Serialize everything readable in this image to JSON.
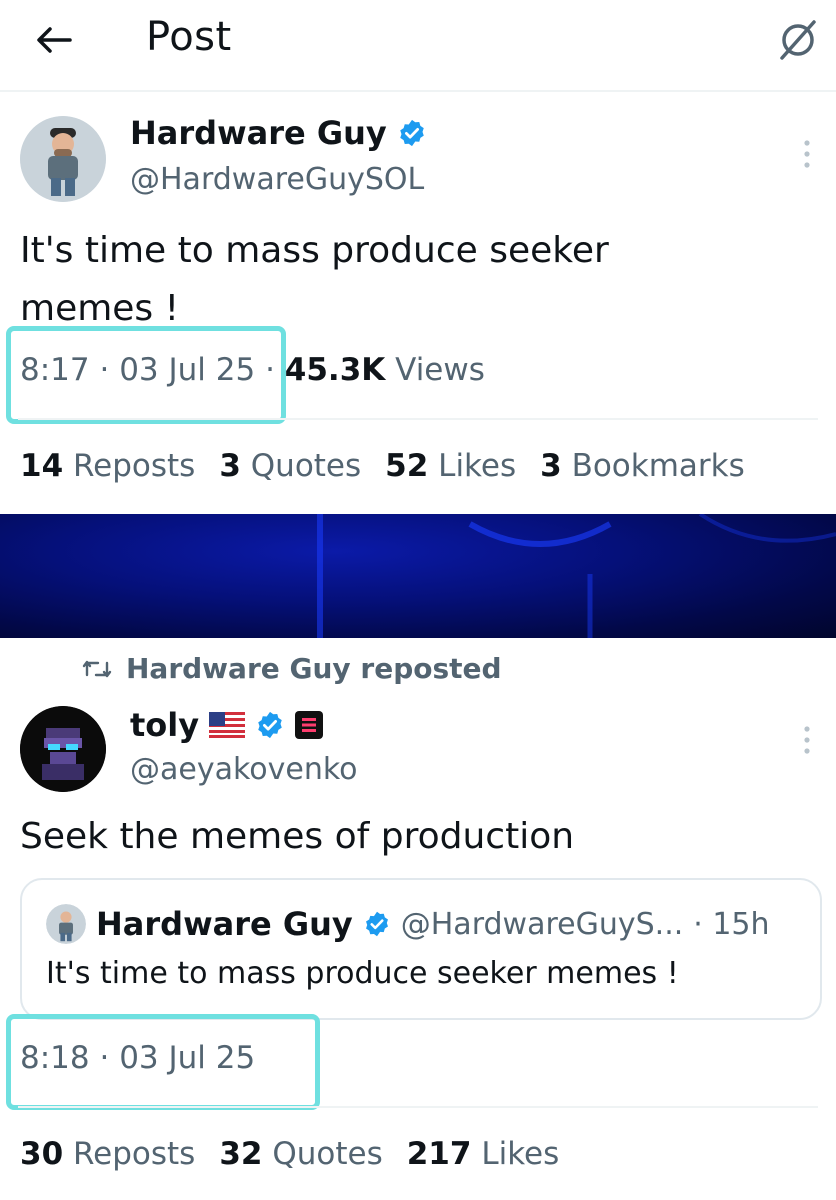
{
  "header": {
    "title": "Post"
  },
  "main_post": {
    "author": {
      "name": "Hardware Guy",
      "handle": "@HardwareGuySOL"
    },
    "text_line1": "It's time to mass produce seeker",
    "text_line2": "memes !",
    "time": "8:17",
    "date": "03 Jul 25",
    "views_count": "45.3K",
    "views_label": "Views",
    "stats": {
      "reposts_count": "14",
      "reposts_label": "Reposts",
      "quotes_count": "3",
      "quotes_label": "Quotes",
      "likes_count": "52",
      "likes_label": "Likes",
      "bookmarks_count": "3",
      "bookmarks_label": "Bookmarks"
    }
  },
  "repost": {
    "label": "Hardware Guy reposted",
    "author": {
      "name": "toly",
      "flag": "🇺🇸",
      "handle": "@aeyakovenko"
    },
    "text": "Seek the memes of production",
    "quote": {
      "name": "Hardware Guy",
      "handle": "@HardwareGuyS...",
      "age": "· 15h",
      "text": "It's time to mass produce seeker memes !"
    },
    "time": "8:18",
    "date": "03 Jul 25",
    "stats": {
      "reposts_count": "30",
      "reposts_label": "Reposts",
      "quotes_count": "32",
      "quotes_label": "Quotes",
      "likes_count": "217",
      "likes_label": "Likes"
    }
  },
  "colors": {
    "accent_blue": "#1d9bf0",
    "highlight_cyan": "#6fe0e0",
    "secondary_text": "#536471",
    "banner": "#05107a"
  },
  "icons": [
    "back-arrow-icon",
    "grok-icon",
    "verified-badge-icon",
    "more-vertical-icon",
    "repost-icon",
    "us-flag-icon",
    "solana-badge-icon"
  ]
}
